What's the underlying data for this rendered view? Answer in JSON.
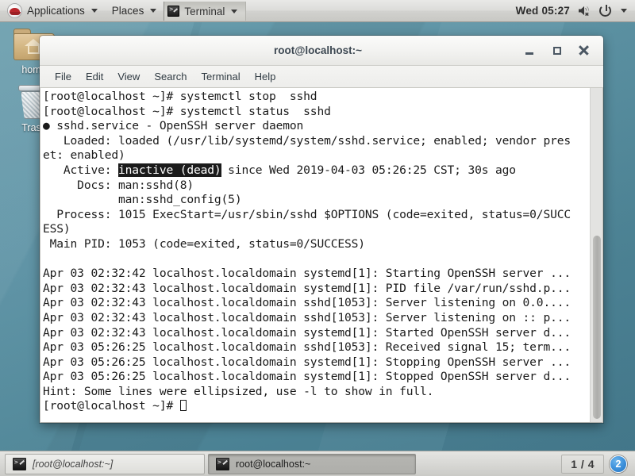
{
  "top_panel": {
    "logo_icon": "redhat-logo-icon",
    "applications_label": "Applications",
    "places_label": "Places",
    "window_label": "Terminal",
    "clock": "Wed 05:27",
    "volume_icon": "speaker-muted-icon",
    "power_icon": "power-icon",
    "system_caret_icon": "chevron-down-icon"
  },
  "desktop": {
    "icons": [
      {
        "label": "home",
        "icon": "home-folder-icon"
      },
      {
        "label": "Trash",
        "icon": "trash-can-icon"
      }
    ]
  },
  "window": {
    "title": "root@localhost:~",
    "buttons": {
      "minimize": "minimize-icon",
      "maximize": "maximize-icon",
      "close": "close-icon"
    },
    "menu": [
      "File",
      "Edit",
      "View",
      "Search",
      "Terminal",
      "Help"
    ]
  },
  "terminal": {
    "lines": [
      {
        "segments": [
          {
            "text": "[root@localhost ~]# systemctl stop  sshd"
          }
        ]
      },
      {
        "segments": [
          {
            "text": "[root@localhost ~]# systemctl status  sshd"
          }
        ]
      },
      {
        "segments": [
          {
            "text": "● sshd.service - OpenSSH server daemon"
          }
        ]
      },
      {
        "segments": [
          {
            "text": "   Loaded: loaded (/usr/lib/systemd/system/sshd.service; enabled; vendor pres"
          }
        ]
      },
      {
        "segments": [
          {
            "text": "et: enabled)"
          }
        ]
      },
      {
        "segments": [
          {
            "text": "   Active: "
          },
          {
            "text": "inactive (dead)",
            "inverse": true
          },
          {
            "text": " since Wed 2019-04-03 05:26:25 CST; 30s ago"
          }
        ]
      },
      {
        "segments": [
          {
            "text": "     Docs: man:sshd(8)"
          }
        ]
      },
      {
        "segments": [
          {
            "text": "           man:sshd_config(5)"
          }
        ]
      },
      {
        "segments": [
          {
            "text": "  Process: 1015 ExecStart=/usr/sbin/sshd $OPTIONS (code=exited, status=0/SUCC"
          }
        ]
      },
      {
        "segments": [
          {
            "text": "ESS)"
          }
        ]
      },
      {
        "segments": [
          {
            "text": " Main PID: 1053 (code=exited, status=0/SUCCESS)"
          }
        ]
      },
      {
        "segments": [
          {
            "text": ""
          }
        ]
      },
      {
        "segments": [
          {
            "text": "Apr 03 02:32:42 localhost.localdomain systemd[1]: Starting OpenSSH server ..."
          }
        ]
      },
      {
        "segments": [
          {
            "text": "Apr 03 02:32:43 localhost.localdomain systemd[1]: PID file /var/run/sshd.p..."
          }
        ]
      },
      {
        "segments": [
          {
            "text": "Apr 03 02:32:43 localhost.localdomain sshd[1053]: Server listening on 0.0...."
          }
        ]
      },
      {
        "segments": [
          {
            "text": "Apr 03 02:32:43 localhost.localdomain sshd[1053]: Server listening on :: p..."
          }
        ]
      },
      {
        "segments": [
          {
            "text": "Apr 03 02:32:43 localhost.localdomain systemd[1]: Started OpenSSH server d..."
          }
        ]
      },
      {
        "segments": [
          {
            "text": "Apr 03 05:26:25 localhost.localdomain sshd[1053]: Received signal 15; term..."
          }
        ]
      },
      {
        "segments": [
          {
            "text": "Apr 03 05:26:25 localhost.localdomain systemd[1]: Stopping OpenSSH server ..."
          }
        ]
      },
      {
        "segments": [
          {
            "text": "Apr 03 05:26:25 localhost.localdomain systemd[1]: Stopped OpenSSH server d..."
          }
        ]
      },
      {
        "segments": [
          {
            "text": "Hint: Some lines were ellipsized, use -l to show in full."
          }
        ]
      },
      {
        "segments": [
          {
            "text": "[root@localhost ~]# "
          },
          {
            "cursor": true
          }
        ]
      }
    ]
  },
  "bottom_panel": {
    "tasks": [
      {
        "label": "[root@localhost:~]",
        "active": false,
        "icon": "terminal-icon"
      },
      {
        "label": "root@localhost:~",
        "active": true,
        "icon": "terminal-icon"
      }
    ],
    "workspace_count_label": "1 / 4",
    "workspace_badge": "2"
  }
}
